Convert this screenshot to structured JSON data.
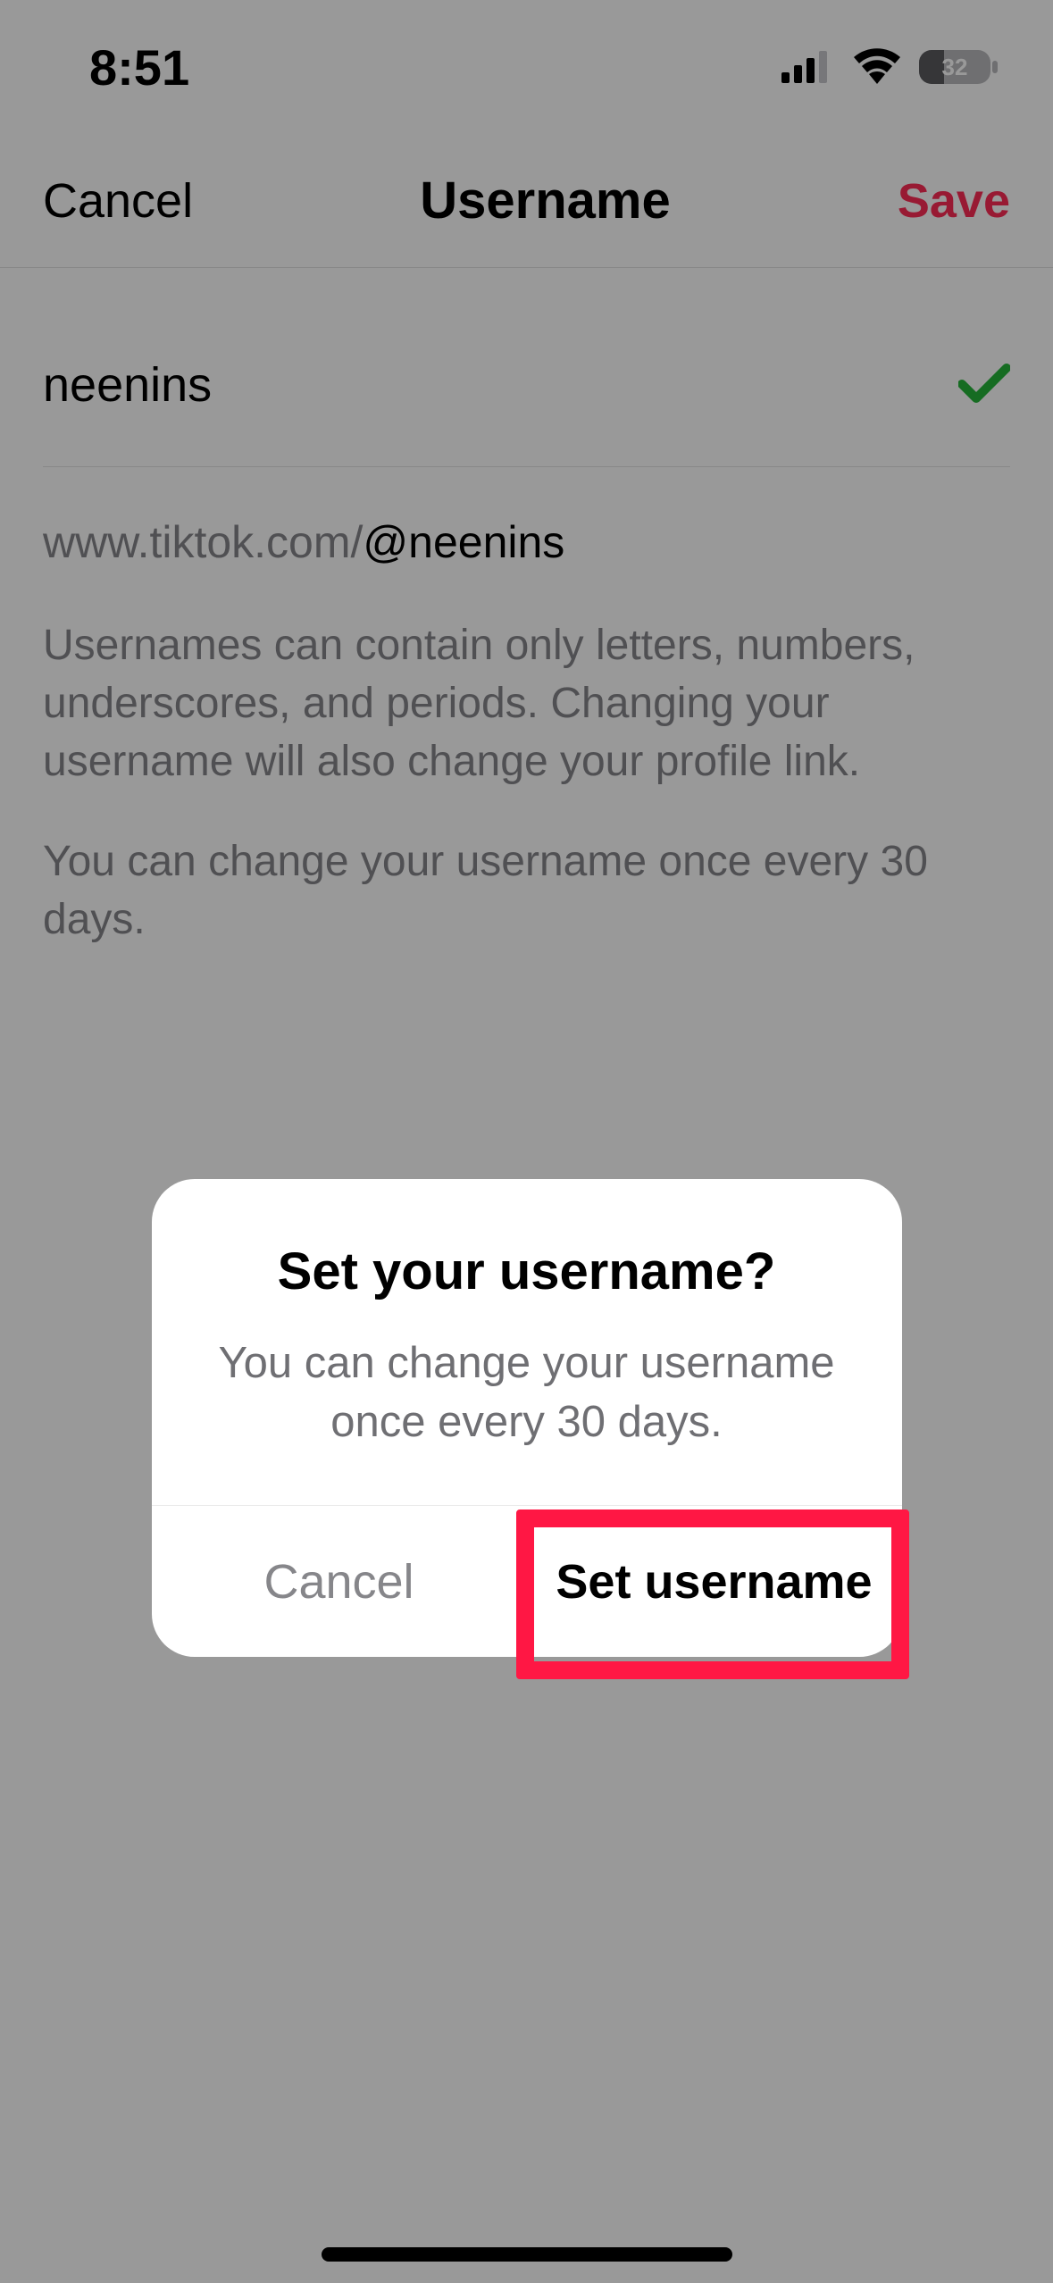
{
  "status_bar": {
    "time": "8:51",
    "battery": "32"
  },
  "nav": {
    "cancel": "Cancel",
    "title": "Username",
    "save": "Save"
  },
  "field": {
    "value": "neenins"
  },
  "link": {
    "prefix": "www.tiktok.com/",
    "handle": "@neenins"
  },
  "helper": {
    "rules": "Usernames can contain only letters, numbers, underscores, and periods. Changing your username will also change your profile link.",
    "limit": "You can change your username once every 30 days."
  },
  "dialog": {
    "title": "Set your username?",
    "message": "You can change your username once every 30 days.",
    "cancel": "Cancel",
    "confirm": "Set username"
  }
}
